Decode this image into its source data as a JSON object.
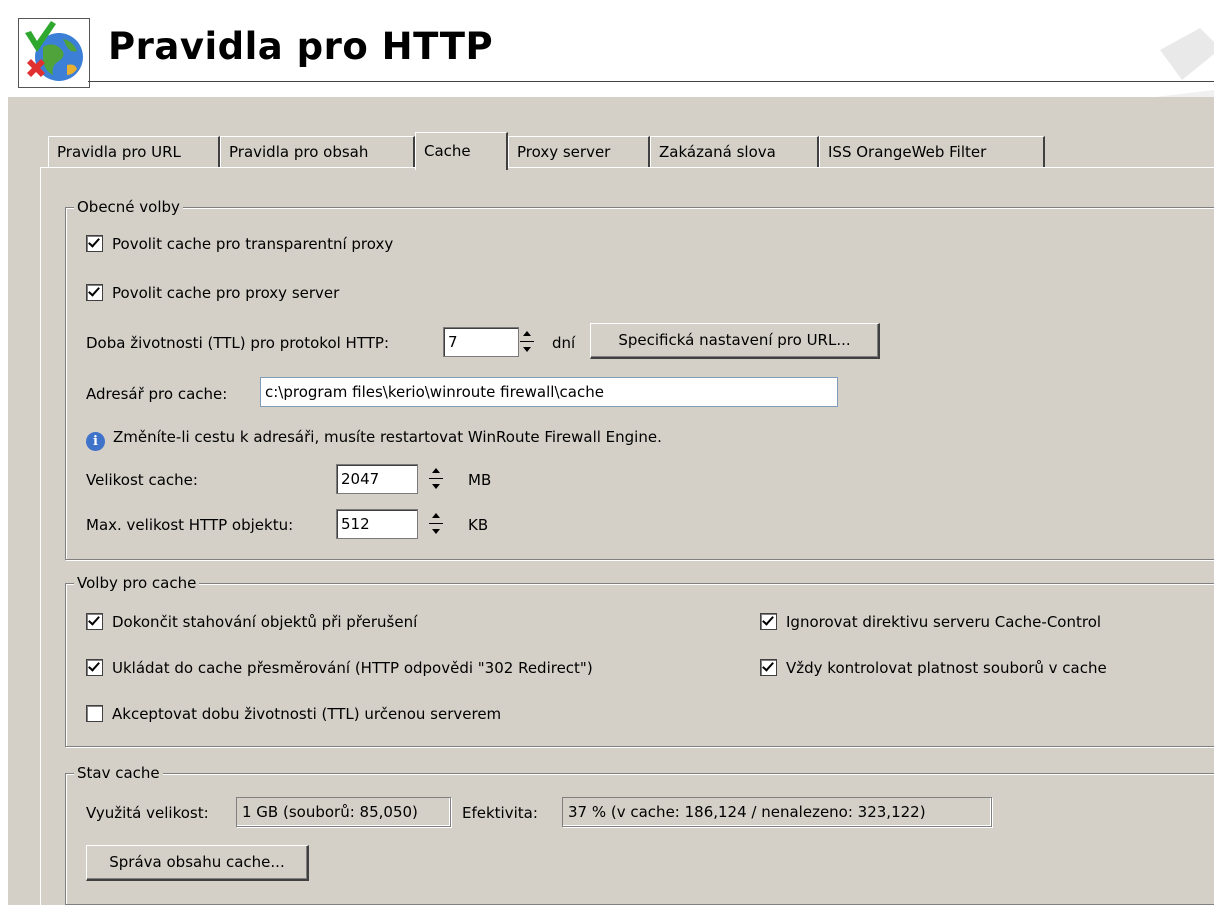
{
  "header": {
    "title": "Pravidla pro HTTP"
  },
  "tabs": [
    {
      "label": "Pravidla pro URL"
    },
    {
      "label": "Pravidla pro obsah"
    },
    {
      "label": "Cache",
      "active": true
    },
    {
      "label": "Proxy server"
    },
    {
      "label": "Zakázaná slova"
    },
    {
      "label": "ISS OrangeWeb Filter"
    }
  ],
  "general": {
    "legend": "Obecné volby",
    "cb_transparent": "Povolit cache pro transparentní proxy",
    "cb_proxy": "Povolit cache pro proxy server",
    "ttl_label": "Doba životnosti (TTL) pro protokol HTTP:",
    "ttl_value": "7",
    "ttl_unit": "dní",
    "url_specific_button": "Specifická nastavení pro URL...",
    "dir_label": "Adresář pro cache:",
    "dir_value": "c:\\program files\\kerio\\winroute firewall\\cache",
    "info_text": "Změníte-li cestu k adresáři, musíte restartovat WinRoute Firewall Engine.",
    "size_label": "Velikost cache:",
    "size_value": "2047",
    "size_unit": "MB",
    "maxobj_label": "Max. velikost HTTP objektu:",
    "maxobj_value": "512",
    "maxobj_unit": "KB"
  },
  "options": {
    "legend": "Volby pro cache",
    "cb_finish": "Dokončit stahování objektů při přerušení",
    "cb_redirect": "Ukládat do cache přesměrování (HTTP odpovědi \"302 Redirect\")",
    "cb_server_ttl": "Akceptovat dobu životnosti (TTL) určenou serverem",
    "cb_ignore": "Ignorovat direktivu serveru Cache-Control",
    "cb_validate": "Vždy kontrolovat platnost souborů v cache"
  },
  "status": {
    "legend": "Stav cache",
    "used_label": "Využitá velikost:",
    "used_value": "1 GB (souborů: 85,050)",
    "eff_label": "Efektivita:",
    "eff_value": "37 % (v cache: 186,124 / nenalezeno: 323,122)",
    "manage_button": "Správa obsahu cache..."
  },
  "colors": {
    "panel": "#d4d0c8",
    "info": "#3f72c9"
  }
}
